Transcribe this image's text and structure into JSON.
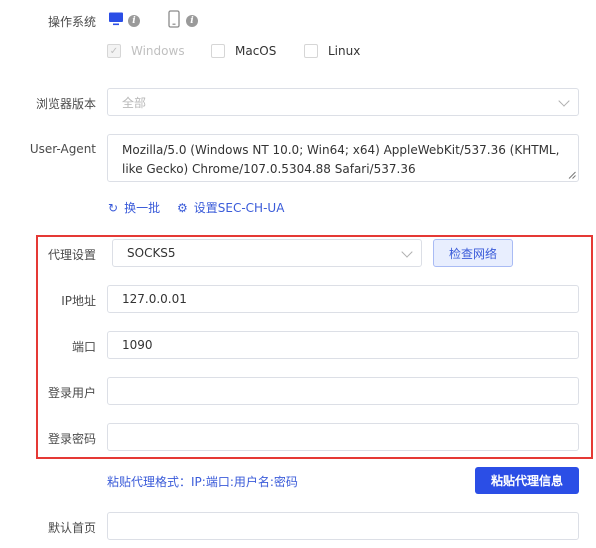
{
  "os": {
    "label": "操作系统",
    "options": [
      {
        "label": "Windows",
        "checked": true,
        "disabled": true
      },
      {
        "label": "MacOS",
        "checked": false,
        "disabled": false
      },
      {
        "label": "Linux",
        "checked": false,
        "disabled": false
      }
    ]
  },
  "browser_version": {
    "label": "浏览器版本",
    "value": "全部"
  },
  "user_agent": {
    "label": "User-Agent",
    "value": "Mozilla/5.0 (Windows NT 10.0; Win64; x64) AppleWebKit/537.36 (KHTML, like Gecko) Chrome/107.0.5304.88 Safari/537.36"
  },
  "actions": {
    "refresh": "换一批",
    "set_ch_ua": "设置SEC-CH-UA"
  },
  "proxy": {
    "settings_label": "代理设置",
    "type_value": "SOCKS5",
    "check_button": "检查网络",
    "ip_label": "IP地址",
    "ip_value": "127.0.0.01",
    "port_label": "端口",
    "port_value": "1090",
    "user_label": "登录用户",
    "user_value": "",
    "password_label": "登录密码",
    "password_value": ""
  },
  "paste": {
    "hint": "粘贴代理格式：IP:端口:用户名:密码",
    "button": "粘贴代理信息"
  },
  "homepage": {
    "label": "默认首页",
    "value": ""
  },
  "colors": {
    "accent": "#2b4ee6",
    "highlight_border": "#e53935"
  }
}
